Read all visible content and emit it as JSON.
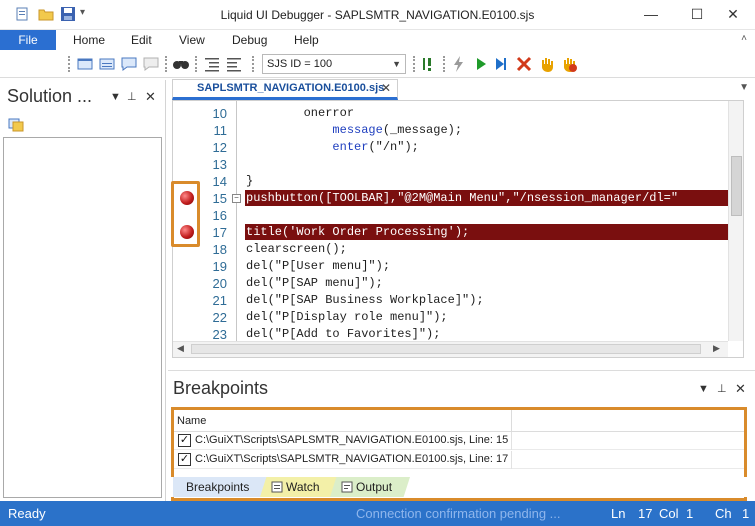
{
  "window": {
    "title": "Liquid UI Debugger - SAPLSMTR_NAVIGATION.E0100.sjs",
    "minimize": "—",
    "maximize": "☐",
    "close": "✕"
  },
  "menu": {
    "file": "File",
    "items": [
      "Home",
      "Edit",
      "View",
      "Debug",
      "Help"
    ]
  },
  "toolbar": {
    "sjs_select": "SJS ID = 100"
  },
  "solution_panel": {
    "title": "Solution ...",
    "pin": "⊥",
    "close": "✕",
    "dropdown": "▼"
  },
  "editor": {
    "tab_label": "SAPLSMTR_NAVIGATION.E0100.sjs",
    "tab_close": "✕",
    "lines": [
      {
        "n": "10",
        "code": "        onerror",
        "bp": false,
        "hl": false
      },
      {
        "n": "11",
        "code": "            message(_message);",
        "bp": false,
        "hl": false
      },
      {
        "n": "12",
        "code": "            enter(\"/n\");",
        "bp": false,
        "hl": false
      },
      {
        "n": "13",
        "code": "",
        "bp": false,
        "hl": false
      },
      {
        "n": "14",
        "code": "}",
        "bp": false,
        "hl": false
      },
      {
        "n": "15",
        "code": "pushbutton([TOOLBAR],\"@2M@Main Menu\",\"/nsession_manager/dl=\"",
        "bp": true,
        "hl": true
      },
      {
        "n": "16",
        "code": "",
        "bp": false,
        "hl": false
      },
      {
        "n": "17",
        "code": "title('Work Order Processing');",
        "bp": true,
        "hl": true
      },
      {
        "n": "18",
        "code": "clearscreen();",
        "bp": false,
        "hl": false
      },
      {
        "n": "19",
        "code": "del(\"P[User menu]\");",
        "bp": false,
        "hl": false
      },
      {
        "n": "20",
        "code": "del(\"P[SAP menu]\");",
        "bp": false,
        "hl": false
      },
      {
        "n": "21",
        "code": "del(\"P[SAP Business Workplace]\");",
        "bp": false,
        "hl": false
      },
      {
        "n": "22",
        "code": "del(\"P[Display role menu]\");",
        "bp": false,
        "hl": false
      },
      {
        "n": "23",
        "code": "del(\"P[Add to Favorites]\");",
        "bp": false,
        "hl": false
      }
    ]
  },
  "breakpoints": {
    "title": "Breakpoints",
    "column": "Name",
    "rows": [
      {
        "checked": true,
        "text": "C:\\GuiXT\\Scripts\\SAPLSMTR_NAVIGATION.E0100.sjs, Line: 15"
      },
      {
        "checked": true,
        "text": "C:\\GuiXT\\Scripts\\SAPLSMTR_NAVIGATION.E0100.sjs, Line: 17"
      }
    ]
  },
  "bottom_tabs": {
    "breakpoints": "Breakpoints",
    "watch": "Watch",
    "output": "Output"
  },
  "status": {
    "ready": "Ready",
    "connection": "Connection confirmation pending ...",
    "ln_label": "Ln",
    "ln": "17",
    "col_label": "Col",
    "col": "1",
    "ch_label": "Ch",
    "ch": "1"
  },
  "colors": {
    "accent": "#2b6fd1",
    "status_bar": "#2b72c9",
    "breakpoint_line": "#7a0f0f",
    "highlight_box": "#d98b2b"
  }
}
